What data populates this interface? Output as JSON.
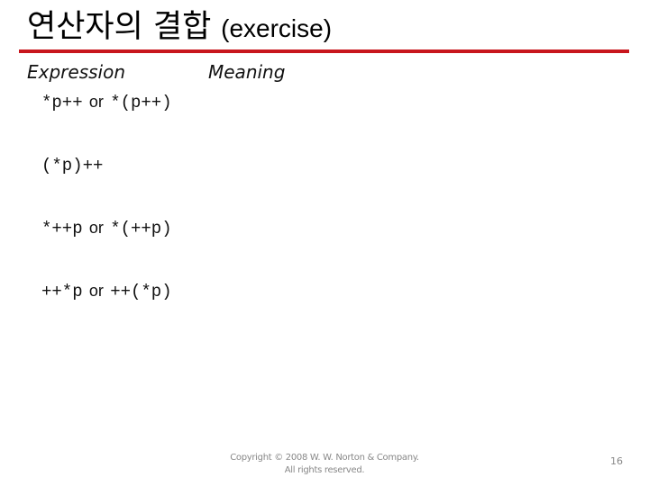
{
  "slide": {
    "title_korean": "연산자의 결합",
    "title_english": "(exercise)",
    "accent_color": "#c8161d"
  },
  "table": {
    "headers": {
      "expression": "Expression",
      "meaning": "Meaning"
    },
    "rows": [
      {
        "form1": "*p++",
        "connector": "or",
        "form2": "*(p++)",
        "meaning": ""
      },
      {
        "form1": "(*p)++",
        "connector": "",
        "form2": "",
        "meaning": ""
      },
      {
        "form1": "*++p",
        "connector": "or",
        "form2": "*(++p)",
        "meaning": ""
      },
      {
        "form1": "++*p",
        "connector": "or",
        "form2": "++(*p)",
        "meaning": ""
      }
    ]
  },
  "footer": {
    "copyright_line1": "Copyright © 2008 W. W. Norton & Company.",
    "copyright_line2": "All rights reserved.",
    "page_number": "16"
  }
}
